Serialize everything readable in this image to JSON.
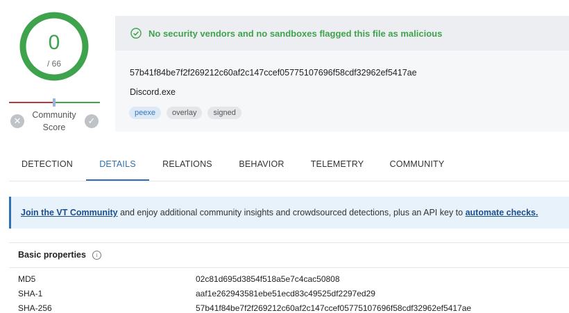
{
  "score": {
    "detections": "0",
    "total": "/ 66",
    "ring_color": "#3fa34d",
    "fraction_flagged": 0
  },
  "community": {
    "label_line1": "Community",
    "label_line2": "Score",
    "negative_color": "#b53b3b",
    "positive_color": "#3fa34d"
  },
  "summary": {
    "status_message": "No security vendors and no sandboxes flagged this file as malicious",
    "status_color": "#3fa34d",
    "hash": "57b41f84be7f2f269212c60af2c147ccef05775107696f58cdf32962ef5417ae",
    "file_name": "Discord.exe",
    "tags": [
      "peexe",
      "overlay",
      "signed"
    ]
  },
  "tabs": [
    {
      "label": "DETECTION",
      "active": false
    },
    {
      "label": "DETAILS",
      "active": true
    },
    {
      "label": "RELATIONS",
      "active": false
    },
    {
      "label": "BEHAVIOR",
      "active": false
    },
    {
      "label": "TELEMETRY",
      "active": false
    },
    {
      "label": "COMMUNITY",
      "active": false
    }
  ],
  "info_banner": {
    "link1": "Join the VT Community",
    "middle": " and enjoy additional community insights and crowdsourced detections, plus an API key to ",
    "link2": "automate checks."
  },
  "basic_properties": {
    "title": "Basic properties",
    "info_icon": "i",
    "rows": [
      {
        "key": "MD5",
        "value": "02c81d695d3854f518a5e7c4cac50808"
      },
      {
        "key": "SHA-1",
        "value": "aaf1e262943581ebe51ecd83c49525df2297ed29"
      },
      {
        "key": "SHA-256",
        "value": "57b41f84be7f2f269212c60af2c147ccef05775107696f58cdf32962ef5417ae"
      }
    ]
  }
}
